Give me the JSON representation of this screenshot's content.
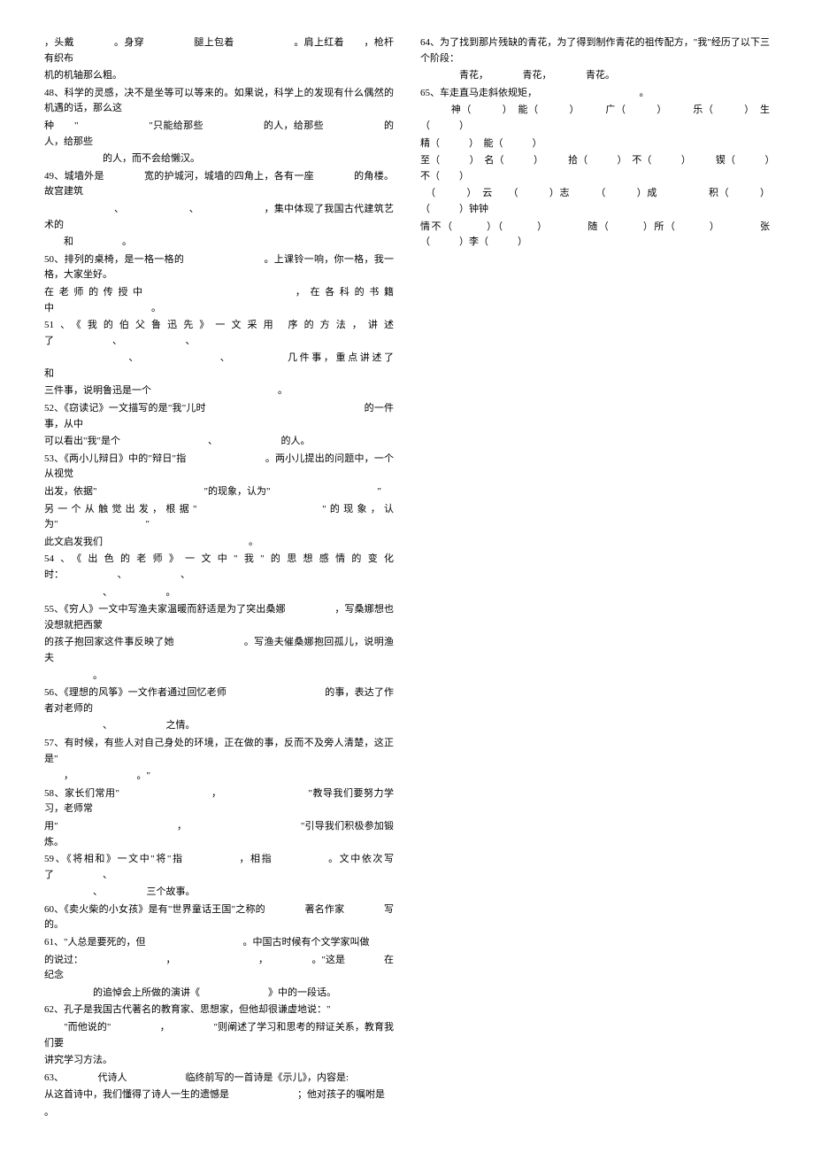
{
  "left": {
    "l47a": "，头戴　　　　。身穿　　　　　腿上包着　　　　　　。肩上红着　　，枪杆有织布",
    "l47b": "机的机轴那么粗。",
    "l48a": "48、科学的灵感，决不是坐等可以等来的。如果说，科学上的发现有什么偶然的机遇的话，那么这",
    "l48b": "种　　\"　　　　　　　\"只能给那些　　　　　　的人，给那些　　　　　　的人，给那些",
    "l48c": "　　　　　　的人，而不会给懒汉。",
    "l49a": "49、城墙外是　　　　宽的护城河，城墙的四角上，各有一座　　　　的角楼。故宫建筑",
    "l49b": "　　　　　　　、　　　　　　　、　　　　　　　，集中体现了我国古代建筑艺术的　　　　",
    "l49c": "　　和　　　　　。",
    "l50a": "50、排列的桌椅，是一格一格的　　　　　　　　。上课铃一响，你一格，我一格，大家坐好。",
    "l50b": "在老师的传授中　　　　　　　　　　，在各科的书籍中　　　　　　　　　　。",
    "l51a": "51、《我的伯父鲁迅先》一文采用 序的方法，讲述了　　　　　　、　　　　　　　、",
    "l51b": "　　　　　　　、　　　　　　　、　　　　　几件事，重点讲述了　　　　　　和",
    "l51c": "三件事，说明鲁迅是一个　　　　　　　　　　　　　。",
    "l52a": "52、《窃读记》一文描写的是\"我\"儿时　　　　　　　　　　　　　　　　的一件事，从中",
    "l52b": "可以看出\"我\"是个　　　　　　　　　、　　　　　　　的人。",
    "l53a": "53、《两小儿辩日》中的\"辩日\"指　　　　　　　　。两小儿提出的问题中，一个从视觉",
    "l53b": "出发，依据\"　　　　　　　　　　　\"的现象，认为\"　　　　　　　　　　　\"",
    "l53c": "另一个从触觉出发，根据\"　　　　　　　　　\"的现象，认为\"　　　　　　　　　\"",
    "l53d": "此文启发我们　　　　　　　　　　　　　　　。",
    "l54a": "54、《出色的老师》一文中\"我\"的思想感情的变化时：　　　　　　、　　　　　　、",
    "l54b": "　　　　　　、　　　　　　。",
    "l55a": "55、《穷人》一文中写渔夫家温暖而舒适是为了突出桑娜　　　　　，写桑娜想也没想就把西蒙",
    "l55b": "的孩子抱回家这件事反映了她　　　　　　　。写渔夫催桑娜抱回孤儿，说明渔夫　　　　　",
    "l55c": "　　　　　。",
    "l56a": "56、《理想的风筝》一文作者通过回忆老师　　　　　　　　　　的事，表达了作者对老师的",
    "l56b": "　　　　　　、　　　　　　之情。",
    "l57a": "57、有时候，有些人对自己身处的环境，正在做的事，反而不及旁人清楚，这正是\"　　　　",
    "l57b": "　　，　　　　　　　。\"",
    "l58a": "58、家长们常用\"　　　　　　　　　，　　　　　　　　　\"教导我们要努力学习，老师常",
    "l58b": "用\"　　　　　　　　　　　　，　　　　　　　　　　　　\"引导我们积极参加锻炼。",
    "l59a": "59、《将相和》一文中\"将\"指　　　　　，相指　　　　　。文中依次写了　　　　　、",
    "l59b": "　　　　　、　　　　　三个故事。",
    "l60a": "60、《卖火柴的小女孩》是有\"世界童话王国\"之称的　　　　著名作家　　　　写 的。",
    "l61a": "61、\"人总是要死的，但　　　　　　　　　　。中国古时候有个文学家叫做　　　　",
    "l61b": "的说过：　　　　　　　　　，　　　　　　　　　，　　　　　。\"这是　　　　在纪念",
    "l61c": "　　　　　的追悼会上所做的演讲《　　　　　　　》中的一段话。",
    "l62a": "62、孔子是我国古代著名的教育家、思想家，但他却很谦虚地说：\"　　　　　　　　　　　",
    "l62b": "　　\"而他说的\"　　　　　，　　　　　\"则阐述了学习和思考的辩证关系，教育我们要",
    "l62c": "讲究学习方法。",
    "l63a": "63、　　　　代诗人　　　　　　临终前写的一首诗是《示儿》，内容是:　　　　　　　　　",
    "l63b": "从这首诗中，我们懂得了诗人一生的遗憾是　　　　　　　；他对孩子的嘱咐是　　　　　　",
    "l63c": "。"
  },
  "right": {
    "l64a": "64、为了找到那片残缺的青花，为了得到制作青花的祖传配方，\"我\"经历了以下三个阶段：",
    "l64b": "　　　　青花，　　　　青花，　　　　青花。",
    "l65a": "65、车走直马走斜依规矩，　　　　　　　　　　　。",
    "row1": "　　　神（　　　）　能（　　　）　　　广（　　　）　　　乐（　　　）　生（　　　）",
    "row2": "精（　　　）　能（　　　）",
    "row3": "至（　　　）　名（　　　）　　　拾（　　　）　不（　　　）　　　锲（　　　）不（　　）",
    "row4": "　（　　　）　云　　（　　　）志　　　（　　　）成　　　　　积（　　　）（　　　）钟钟",
    "row5": "情不（　　　）（　　　）　　　　随（　　　）所（　　　）　　　　张（　　　）李（　　　）"
  }
}
